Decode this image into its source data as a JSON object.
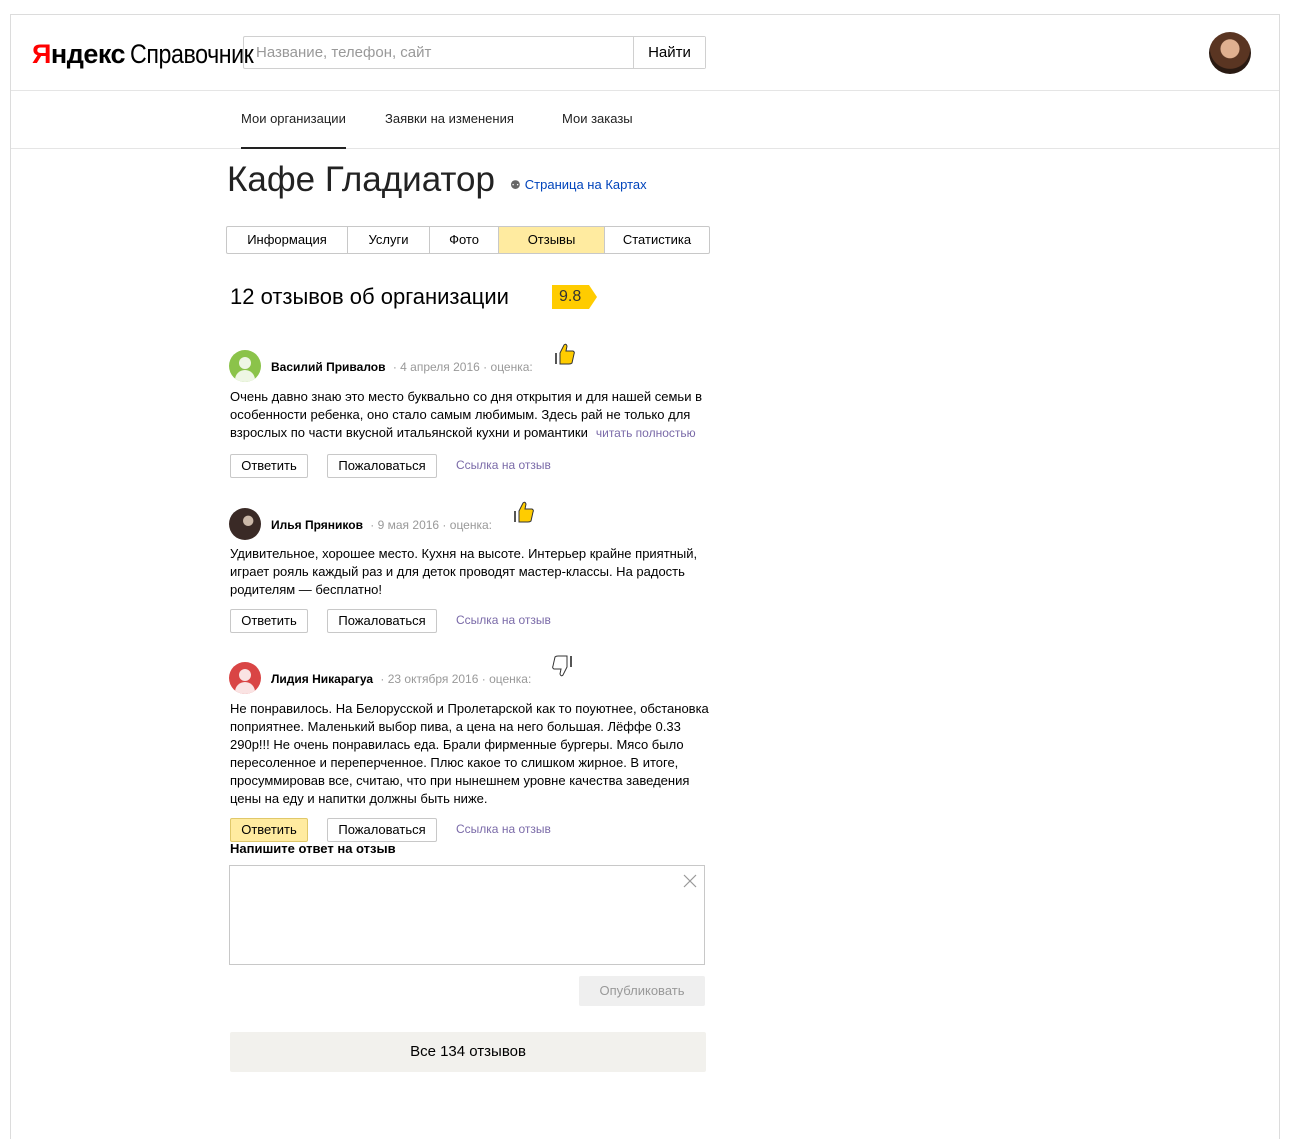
{
  "header": {
    "logo_brand_part1": "Я",
    "logo_brand_part2": "ндекс",
    "logo_service": "Справочник",
    "search_placeholder": "Название, телефон, сайт",
    "search_button": "Найти"
  },
  "nav": {
    "items": [
      {
        "label": "Мои организации",
        "active": true
      },
      {
        "label": "Заявки на изменения",
        "active": false
      },
      {
        "label": "Мои заказы",
        "active": false
      }
    ]
  },
  "org": {
    "title": "Кафе Гладиатор",
    "map_link": "Страница на Картах"
  },
  "tabs": [
    {
      "label": "Информация",
      "active": false
    },
    {
      "label": "Услуги",
      "active": false
    },
    {
      "label": "Фото",
      "active": false
    },
    {
      "label": "Отзывы",
      "active": true
    },
    {
      "label": "Статистика",
      "active": false
    }
  ],
  "reviews": {
    "title": "12 отзывов об организации",
    "rating": "9.8",
    "rating_label": "оценка:",
    "reply_label": "Ответить",
    "complain_label": "Пожаловаться",
    "link_label": "Ссылка на отзыв",
    "read_more": "читать полностью",
    "items": [
      {
        "author": "Василий Привалов",
        "date": "4 апреля 2016",
        "rating": "thumbs-up",
        "avatar_color": "#8bc34a",
        "text": "Очень давно знаю это место буквально со дня открытия и для нашей семьи в особенности ребенка, оно стало самым любимым. Здесь рай не только для взрослых по части вкусной итальянской кухни и романтики"
      },
      {
        "author": "Илья Пряников",
        "date": "9 мая 2016",
        "rating": "thumbs-up",
        "avatar_color": "#3a2a26",
        "text": "Удивительное, хорошее место. Кухня на высоте. Интерьер крайне приятный, играет рояль каждый раз и для деток проводят мастер-классы. На радость родителям — бесплатно!"
      },
      {
        "author": "Лидия Никарагуа",
        "date": "23 октября 2016",
        "rating": "thumbs-down",
        "avatar_color": "#d94545",
        "text": "Не понравилось. На Белорусской и Пролетарской как то поуютнее, обстановка поприятнее. Маленький выбор пива, а цена на него большая. Лёффе 0.33 290р!!! Не очень понравилась еда. Брали фирменные бургеры. Мясо было пересоленное и переперченное. Плюс какое то слишком жирное. В итоге, просуммировав все, считаю, что при нынешнем уровне качества заведения цены на еду и напитки должны быть ниже."
      }
    ]
  },
  "reply_form": {
    "label": "Напишите ответ на отзыв",
    "value": "",
    "publish_button": "Опубликовать"
  },
  "all_reviews_button": "Все 134 отзывов",
  "colors": {
    "accent_yellow": "#ffeba0",
    "rating_yellow": "#ffcc00",
    "link_blue": "#0044bb",
    "link_purple": "#7a6aa8"
  }
}
